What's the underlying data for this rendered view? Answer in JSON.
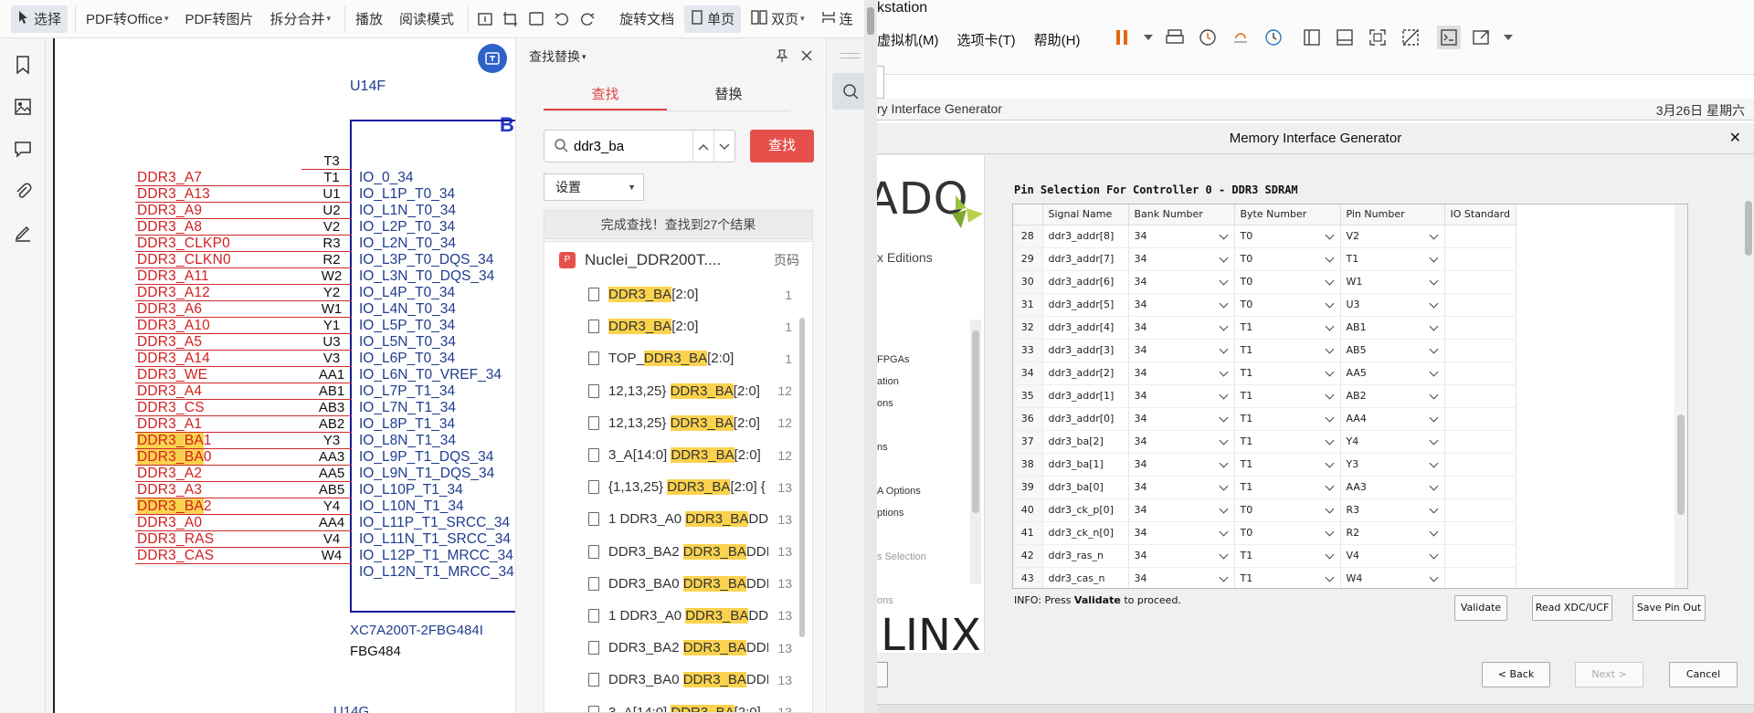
{
  "pdf_toolbar": {
    "select_label": "选择",
    "pdf_to_office": "PDF转Office",
    "pdf_to_image": "PDF转图片",
    "split_merge": "拆分合并",
    "play": "播放",
    "read_mode": "阅读模式",
    "rotate_doc": "旋转文档",
    "single_page": "单页",
    "double_page": "双页",
    "continuous": "连"
  },
  "schematic": {
    "part_label": "U14F",
    "bank_label": "B",
    "part_number": "XC7A200T-2FBG484I",
    "package": "FBG484",
    "next_part": "U14G",
    "first_pin": "T3",
    "first_io": "IO_0_34",
    "rows": [
      {
        "signal": "DDR3_A7",
        "hl": "",
        "rest": "",
        "pin": "T1",
        "io": "IO_L1P_T0_34"
      },
      {
        "signal": "DDR3_A13",
        "hl": "",
        "rest": "",
        "pin": "U1",
        "io": "IO_L1N_T0_34"
      },
      {
        "signal": "DDR3_A9",
        "hl": "",
        "rest": "",
        "pin": "U2",
        "io": "IO_L2P_T0_34"
      },
      {
        "signal": "DDR3_A8",
        "hl": "",
        "rest": "",
        "pin": "V2",
        "io": "IO_L2N_T0_34"
      },
      {
        "signal": "DDR3_CLKP0",
        "hl": "",
        "rest": "",
        "pin": "R3",
        "io": "IO_L3P_T0_DQS_34"
      },
      {
        "signal": "DDR3_CLKN0",
        "hl": "",
        "rest": "",
        "pin": "R2",
        "io": "IO_L3N_T0_DQS_34"
      },
      {
        "signal": "DDR3_A11",
        "hl": "",
        "rest": "",
        "pin": "W2",
        "io": "IO_L4P_T0_34"
      },
      {
        "signal": "DDR3_A12",
        "hl": "",
        "rest": "",
        "pin": "Y2",
        "io": "IO_L4N_T0_34"
      },
      {
        "signal": "DDR3_A6",
        "hl": "",
        "rest": "",
        "pin": "W1",
        "io": "IO_L5P_T0_34"
      },
      {
        "signal": "DDR3_A10",
        "hl": "",
        "rest": "",
        "pin": "Y1",
        "io": "IO_L5N_T0_34"
      },
      {
        "signal": "DDR3_A5",
        "hl": "",
        "rest": "",
        "pin": "U3",
        "io": "IO_L6P_T0_34"
      },
      {
        "signal": "DDR3_A14",
        "hl": "",
        "rest": "",
        "pin": "V3",
        "io": "IO_L6N_T0_VREF_34"
      },
      {
        "signal": "DDR3_WE",
        "hl": "",
        "rest": "",
        "pin": "AA1",
        "io": "IO_L7P_T1_34"
      },
      {
        "signal": "DDR3_A4",
        "hl": "",
        "rest": "",
        "pin": "AB1",
        "io": "IO_L7N_T1_34"
      },
      {
        "signal": "DDR3_CS",
        "hl": "",
        "rest": "",
        "pin": "AB3",
        "io": "IO_L8P_T1_34"
      },
      {
        "signal": "DDR3_A1",
        "hl": "",
        "rest": "",
        "pin": "AB2",
        "io": "IO_L8N_T1_34"
      },
      {
        "signal": "",
        "hl": "DDR3_BA",
        "rest": "1",
        "pin": "Y3",
        "io": "IO_L9P_T1_DQS_34"
      },
      {
        "signal": "",
        "hl": "DDR3_BA",
        "rest": "0",
        "pin": "AA3",
        "io": "IO_L9N_T1_DQS_34"
      },
      {
        "signal": "DDR3_A2",
        "hl": "",
        "rest": "",
        "pin": "AA5",
        "io": "IO_L10P_T1_34"
      },
      {
        "signal": "DDR3_A3",
        "hl": "",
        "rest": "",
        "pin": "AB5",
        "io": "IO_L10N_T1_34"
      },
      {
        "signal": "",
        "hl": "DDR3_BA",
        "rest": "2",
        "pin": "Y4",
        "io": "IO_L11P_T1_SRCC_34"
      },
      {
        "signal": "DDR3_A0",
        "hl": "",
        "rest": "",
        "pin": "AA4",
        "io": "IO_L11N_T1_SRCC_34"
      },
      {
        "signal": "DDR3_RAS",
        "hl": "",
        "rest": "",
        "pin": "V4",
        "io": "IO_L12P_T1_MRCC_34"
      },
      {
        "signal": "DDR3_CAS",
        "hl": "",
        "rest": "",
        "pin": "W4",
        "io": "IO_L12N_T1_MRCC_34"
      }
    ]
  },
  "find_panel": {
    "title": "查找替换",
    "tab_find": "查找",
    "tab_replace": "替换",
    "query": "ddr3_ba",
    "find_button": "查找",
    "settings_label": "设置",
    "status": "完成查找！查找到27个结果",
    "file_name": "Nuclei_DDR200T....",
    "page_col": "页码",
    "results": [
      {
        "pre": "",
        "hl": "DDR3_BA",
        "post": "[2:0]",
        "page": "1"
      },
      {
        "pre": "",
        "hl": "DDR3_BA",
        "post": "[2:0]",
        "page": "1"
      },
      {
        "pre": "TOP_",
        "hl": "DDR3_BA",
        "post": "[2:0]",
        "page": "1"
      },
      {
        "pre": "12,13,25} ",
        "hl": "DDR3_BA",
        "post": "[2:0]",
        "page": "12"
      },
      {
        "pre": "12,13,25} ",
        "hl": "DDR3_BA",
        "post": "[2:0]",
        "page": "12"
      },
      {
        "pre": "3_A[14:0] ",
        "hl": "DDR3_BA",
        "post": "[2:0]",
        "page": "12"
      },
      {
        "pre": "{1,13,25} ",
        "hl": "DDR3_BA",
        "post": "[2:0] {",
        "page": "13"
      },
      {
        "pre": "1 DDR3_A0 ",
        "hl": "DDR3_BA",
        "post": "DD",
        "page": "13"
      },
      {
        "pre": "DDR3_BA2 ",
        "hl": "DDR3_BA",
        "post": "DDI",
        "page": "13"
      },
      {
        "pre": "DDR3_BA0 ",
        "hl": "DDR3_BA",
        "post": "DDI",
        "page": "13"
      },
      {
        "pre": "1 DDR3_A0 ",
        "hl": "DDR3_BA",
        "post": "DD",
        "page": "13"
      },
      {
        "pre": "DDR3_BA2 ",
        "hl": "DDR3_BA",
        "post": "DDI",
        "page": "13"
      },
      {
        "pre": "DDR3_BA0 ",
        "hl": "DDR3_BA",
        "post": "DDI",
        "page": "13"
      },
      {
        "pre": "3_A[14:0] ",
        "hl": "DDR3_BA",
        "post": "[2:0]",
        "page": "13"
      }
    ]
  },
  "vmware": {
    "title_fragment": "kstation",
    "menu": [
      "虚拟机(M)",
      "选项卡(T)",
      "帮助(H)"
    ],
    "guest_title": "ry Interface Generator",
    "guest_clock": "3月26日 星期六"
  },
  "mig": {
    "title": "Memory Interface Generator",
    "logo_fragment": "ADO",
    "editions": "x Editions",
    "nav": [
      "FPGAs",
      "ation",
      "ons",
      "ns",
      "A Options",
      "ptions",
      "s Selection",
      "ons"
    ],
    "brand": "ILINX",
    "section_title": "Pin Selection For Controller 0 - DDR3 SDRAM",
    "columns": [
      "",
      "Signal Name",
      "Bank Number",
      "Byte Number",
      "Pin Number",
      "IO Standard"
    ],
    "rows": [
      {
        "n": "28",
        "sig": "ddr3_addr[8]",
        "bank": "34",
        "byte": "T0",
        "pin": "V2"
      },
      {
        "n": "29",
        "sig": "ddr3_addr[7]",
        "bank": "34",
        "byte": "T0",
        "pin": "T1"
      },
      {
        "n": "30",
        "sig": "ddr3_addr[6]",
        "bank": "34",
        "byte": "T0",
        "pin": "W1"
      },
      {
        "n": "31",
        "sig": "ddr3_addr[5]",
        "bank": "34",
        "byte": "T0",
        "pin": "U3"
      },
      {
        "n": "32",
        "sig": "ddr3_addr[4]",
        "bank": "34",
        "byte": "T1",
        "pin": "AB1"
      },
      {
        "n": "33",
        "sig": "ddr3_addr[3]",
        "bank": "34",
        "byte": "T1",
        "pin": "AB5"
      },
      {
        "n": "34",
        "sig": "ddr3_addr[2]",
        "bank": "34",
        "byte": "T1",
        "pin": "AA5"
      },
      {
        "n": "35",
        "sig": "ddr3_addr[1]",
        "bank": "34",
        "byte": "T1",
        "pin": "AB2"
      },
      {
        "n": "36",
        "sig": "ddr3_addr[0]",
        "bank": "34",
        "byte": "T1",
        "pin": "AA4"
      },
      {
        "n": "37",
        "sig": "ddr3_ba[2]",
        "bank": "34",
        "byte": "T1",
        "pin": "Y4"
      },
      {
        "n": "38",
        "sig": "ddr3_ba[1]",
        "bank": "34",
        "byte": "T1",
        "pin": "Y3"
      },
      {
        "n": "39",
        "sig": "ddr3_ba[0]",
        "bank": "34",
        "byte": "T1",
        "pin": "AA3"
      },
      {
        "n": "40",
        "sig": "ddr3_ck_p[0]",
        "bank": "34",
        "byte": "T0",
        "pin": "R3"
      },
      {
        "n": "41",
        "sig": "ddr3_ck_n[0]",
        "bank": "34",
        "byte": "T0",
        "pin": "R2"
      },
      {
        "n": "42",
        "sig": "ddr3_ras_n",
        "bank": "34",
        "byte": "T1",
        "pin": "V4"
      },
      {
        "n": "43",
        "sig": "ddr3_cas_n",
        "bank": "34",
        "byte": "T1",
        "pin": "W4"
      }
    ],
    "info_prefix": "INFO: Press ",
    "info_bold": "Validate",
    "info_suffix": " to proceed.",
    "btn_validate": "Validate",
    "btn_read": "Read XDC/UCF",
    "btn_save": "Save Pin Out",
    "btn_back": "< Back",
    "btn_next": "Next >",
    "btn_cancel": "Cancel"
  }
}
